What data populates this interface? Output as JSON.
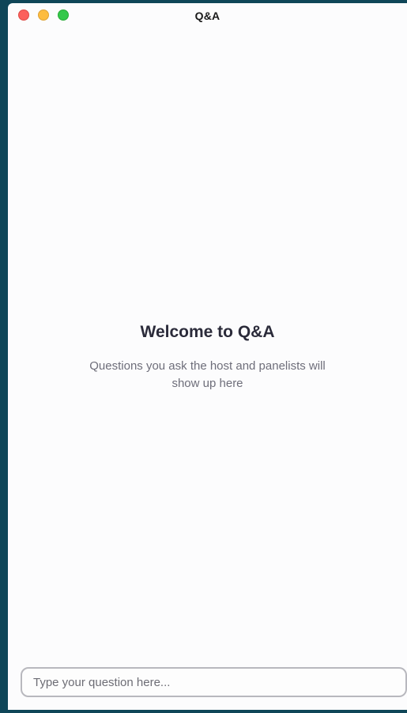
{
  "window": {
    "title": "Q&A",
    "controls": [
      "close",
      "minimize",
      "zoom"
    ]
  },
  "empty_state": {
    "title": "Welcome to Q&A",
    "description": "Questions you ask the host and panelists will show up here"
  },
  "question_input": {
    "value": "",
    "placeholder": "Type your question here..."
  }
}
